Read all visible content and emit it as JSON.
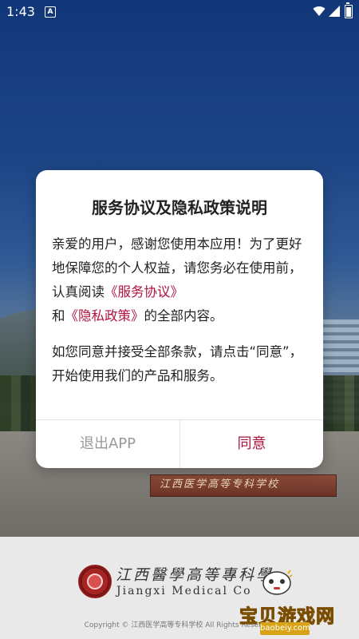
{
  "status_bar": {
    "time": "1:43",
    "notification_icon": "A"
  },
  "dialog": {
    "title": "服务协议及隐私政策说明",
    "body": {
      "p1_text_1": "亲爱的用户，感谢您使用本应用！为了更好地保障您的个人权益，请您务必在使用前，认真阅读",
      "service_link": "《服务协议》",
      "p1_text_2": "和",
      "privacy_link": "《隐私政策》",
      "p1_text_3": "的全部内容。",
      "p2": "如您同意并接受全部条款，请点击“同意”，开始使用我们的产品和服务。"
    },
    "buttons": {
      "exit": "退出APP",
      "agree": "同意"
    }
  },
  "background": {
    "gate_text": "江西医学高等专科学校"
  },
  "footer": {
    "school_name_cn": "江西醫學高等專科學",
    "school_name_en": "Jiangxi Medical Co",
    "copyright": "Copyright © 江西医学高等专科学校 All Rights Reserved"
  },
  "watermark": {
    "text": "宝贝游戏网",
    "url": "baobeiy.com"
  },
  "colors": {
    "accent": "#b01340",
    "exit_button": "#9a9a9a",
    "footer_bg": "#e9e9e9"
  },
  "icons": [
    "wifi-icon",
    "signal-icon",
    "battery-icon",
    "notification-icon"
  ]
}
